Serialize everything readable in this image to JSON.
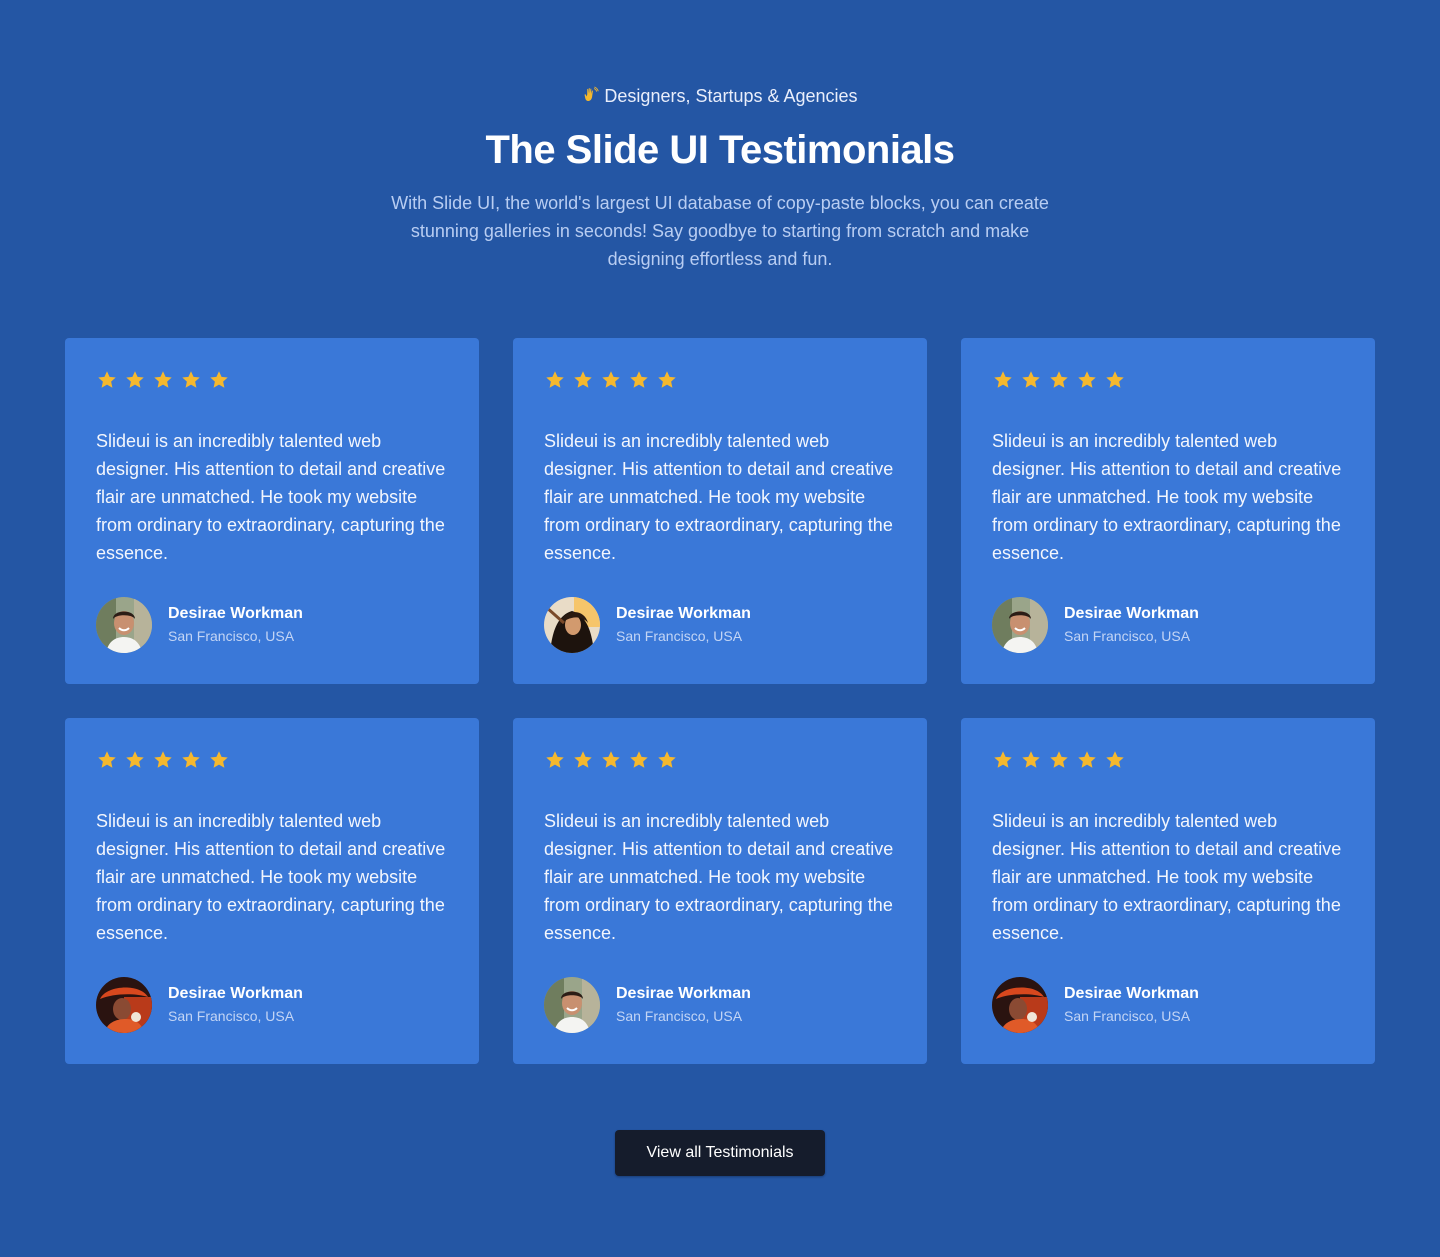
{
  "header": {
    "eyebrow": "Designers, Startups & Agencies",
    "eyebrow_icon": "waving-hand-icon",
    "title": "The Slide UI Testimonials",
    "subtitle": "With Slide UI, the world's largest UI database of copy-paste blocks, you can create stunning galleries in seconds! Say goodbye to starting from scratch and make designing effortless and fun."
  },
  "colors": {
    "background": "#2456a4",
    "card": "#3a78d8",
    "star": "#f5b82e",
    "button": "#151c2c"
  },
  "testimonials": [
    {
      "rating": 5,
      "quote": "Slideui is an incredibly talented web designer. His attention to detail and creative flair are unmatched. He took my website from ordinary to extraordinary, capturing the essence.",
      "name": "Desirae Workman",
      "location": "San Francisco, USA",
      "avatar": "man-smiling-avatar"
    },
    {
      "rating": 5,
      "quote": "Slideui is an incredibly talented web designer. His attention to detail and creative flair are unmatched. He took my website from ordinary to extraordinary, capturing the essence.",
      "name": "Desirae Workman",
      "location": "San Francisco, USA",
      "avatar": "woman-dark-hair-avatar"
    },
    {
      "rating": 5,
      "quote": "Slideui is an incredibly talented web designer. His attention to detail and creative flair are unmatched. He took my website from ordinary to extraordinary, capturing the essence.",
      "name": "Desirae Workman",
      "location": "San Francisco, USA",
      "avatar": "man-smiling-avatar"
    },
    {
      "rating": 5,
      "quote": "Slideui is an incredibly talented web designer. His attention to detail and creative flair are unmatched. He took my website from ordinary to extraordinary, capturing the essence.",
      "name": "Desirae Workman",
      "location": "San Francisco, USA",
      "avatar": "person-red-hat-avatar"
    },
    {
      "rating": 5,
      "quote": "Slideui is an incredibly talented web designer. His attention to detail and creative flair are unmatched. He took my website from ordinary to extraordinary, capturing the essence.",
      "name": "Desirae Workman",
      "location": "San Francisco, USA",
      "avatar": "man-smiling-avatar"
    },
    {
      "rating": 5,
      "quote": "Slideui is an incredibly talented web designer. His attention to detail and creative flair are unmatched. He took my website from ordinary to extraordinary, capturing the essence.",
      "name": "Desirae Workman",
      "location": "San Francisco, USA",
      "avatar": "person-red-hat-avatar"
    }
  ],
  "cta": {
    "label": "View all Testimonials"
  }
}
